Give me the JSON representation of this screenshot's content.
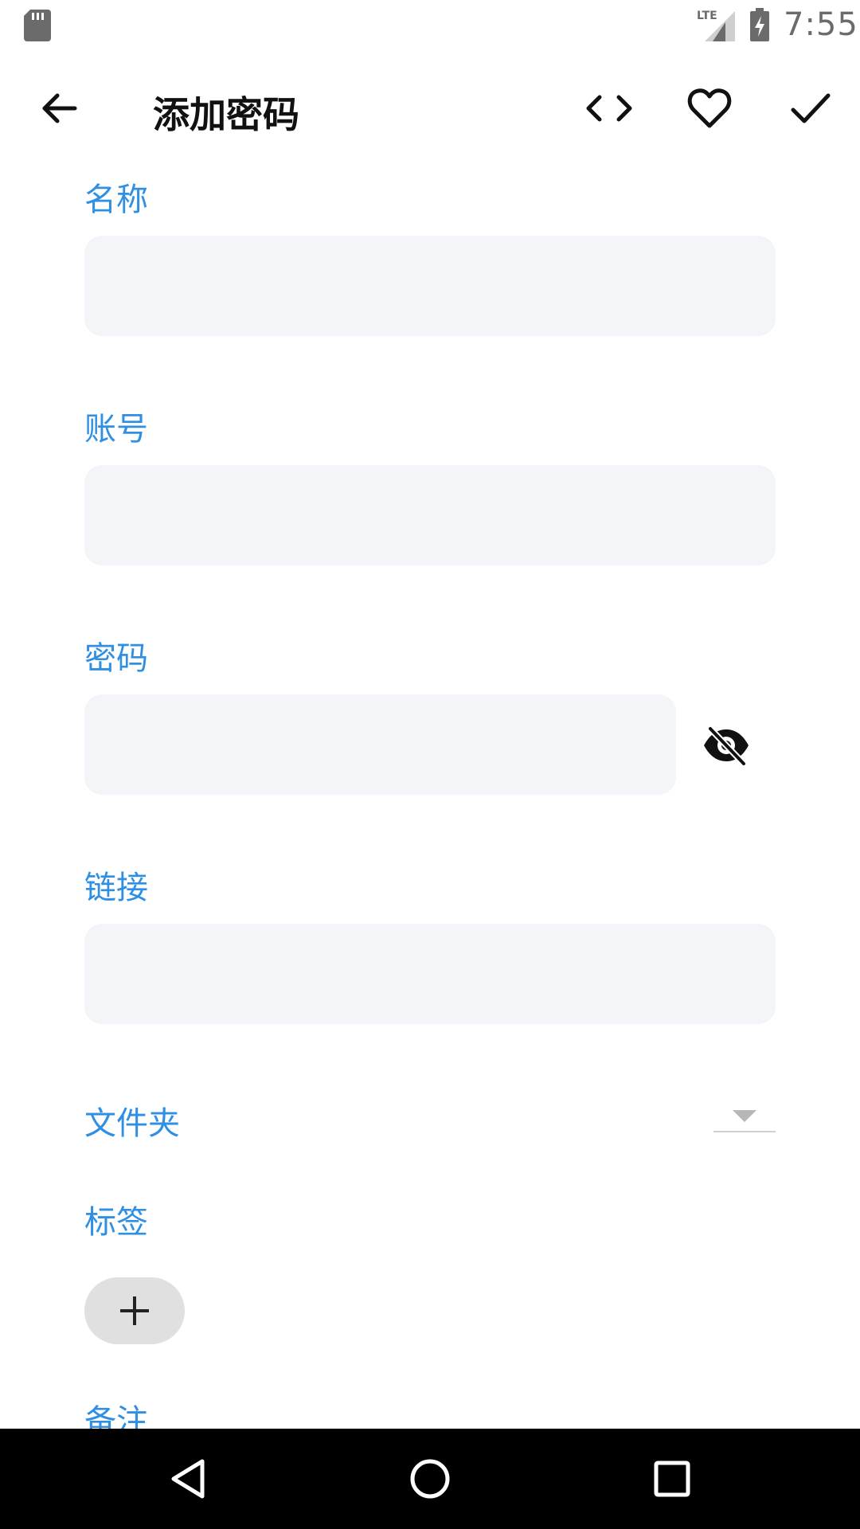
{
  "status_bar": {
    "time": "7:55",
    "network_label": "LTE",
    "icons": [
      "sd-card-icon",
      "lte-signal-icon",
      "battery-charging-icon"
    ]
  },
  "app_bar": {
    "title": "添加密码",
    "icons": [
      "back-arrow-icon",
      "code-icon",
      "heart-icon",
      "check-icon"
    ]
  },
  "form": {
    "name": {
      "label": "名称",
      "value": "",
      "placeholder": ""
    },
    "account": {
      "label": "账号",
      "value": "",
      "placeholder": ""
    },
    "password": {
      "label": "密码",
      "value": "",
      "placeholder": "",
      "visibility_icon": "eye-off-icon"
    },
    "link": {
      "label": "链接",
      "value": "",
      "placeholder": ""
    },
    "folder": {
      "label": "文件夹",
      "selected": ""
    },
    "tags": {
      "label": "标签",
      "add_icon": "plus-icon"
    },
    "notes": {
      "label": "备注"
    }
  },
  "nav_bar": {
    "icons": [
      "nav-back-icon",
      "nav-home-icon",
      "nav-recents-icon"
    ]
  },
  "colors": {
    "accent": "#2f8fe3",
    "field_background": "#f4f5f8",
    "chip_background": "#e0e0e0",
    "nav_background": "#000000"
  }
}
